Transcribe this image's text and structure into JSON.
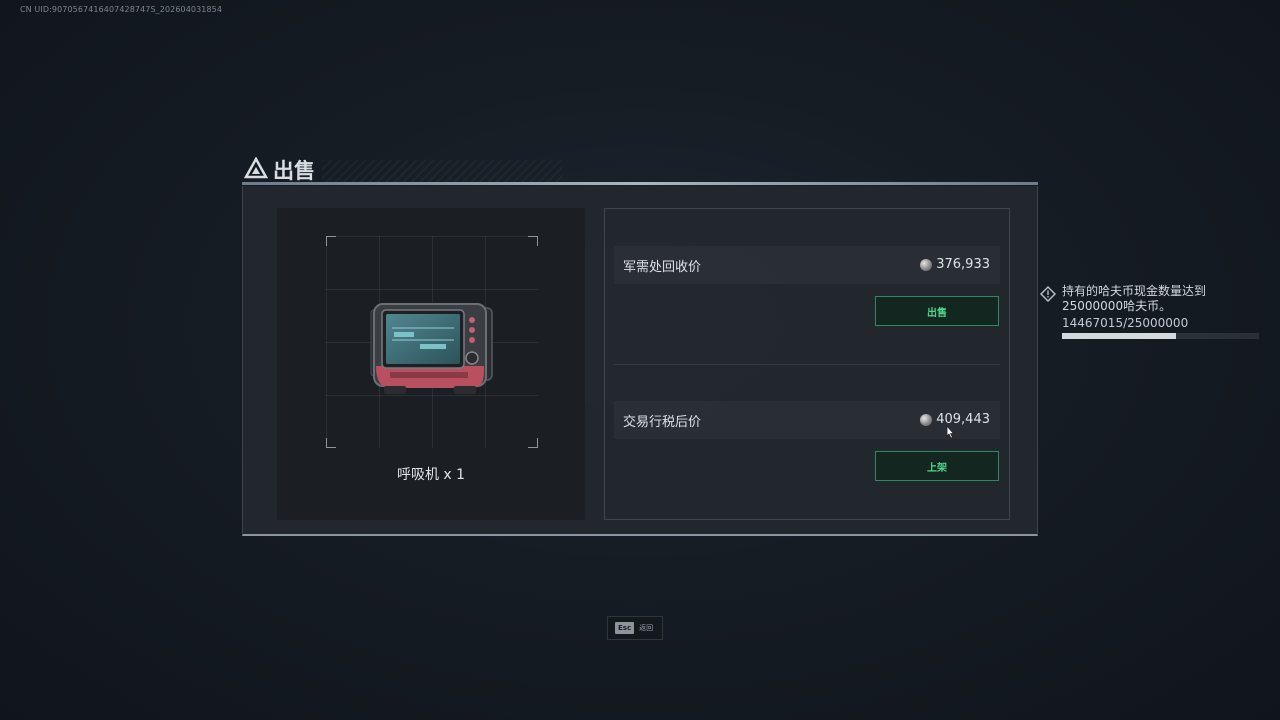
{
  "uid_text": "CN UID:9070567416407428747S_202604031854",
  "dialog": {
    "title": "出售",
    "item_name": "呼吸机 x 1",
    "fill_amount": 1
  },
  "price_rows": [
    {
      "label": "军需处回收价",
      "value": "376,933",
      "button_label": "出售"
    },
    {
      "label": "交易行税后价",
      "value": "409,443",
      "button_label": "上架"
    }
  ],
  "quest": {
    "text": "持有的哈夫币现金数量达到25000000哈夫币。",
    "progress_text": "14467015/25000000",
    "current": 14467015,
    "target": 25000000
  },
  "footer": {
    "esc_key": "Esc",
    "esc_label": "返回"
  },
  "colors": {
    "accent_green": "#4fd58c",
    "button_border": "#2e8a5e",
    "item_red": "#b8505f"
  }
}
